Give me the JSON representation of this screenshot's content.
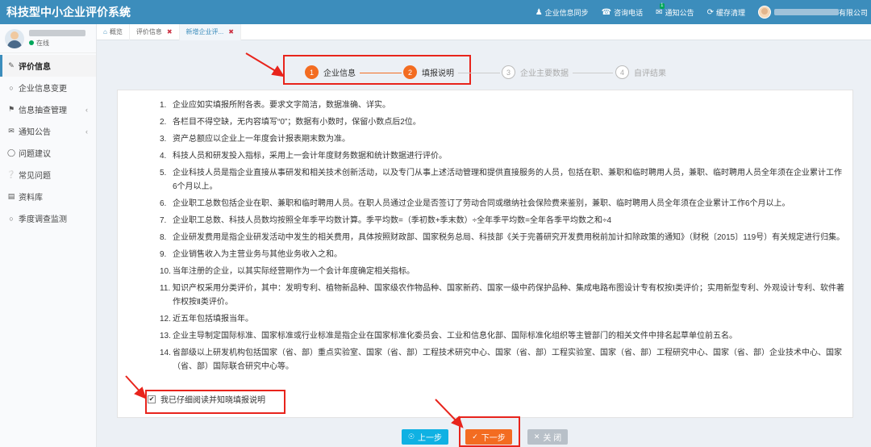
{
  "app": {
    "title": "科技型中小企业评价系统"
  },
  "topnav": {
    "items": [
      {
        "label": "企业信息同步",
        "icon": "user-icon"
      },
      {
        "label": "咨询电话",
        "icon": "phone-icon"
      },
      {
        "label": "通知公告",
        "icon": "envelope-icon",
        "badge": "1"
      },
      {
        "label": "缓存清理",
        "icon": "refresh-icon"
      }
    ],
    "company_suffix": "有限公司"
  },
  "user": {
    "status": "在线"
  },
  "sidebar": {
    "items": [
      {
        "label": "评价信息",
        "icon": "edit-icon",
        "active": true
      },
      {
        "label": "企业信息变更",
        "icon": "circle-icon"
      },
      {
        "label": "信息抽查管理",
        "icon": "tag-icon",
        "has_arrow": true
      },
      {
        "label": "通知公告",
        "icon": "envelope-icon",
        "has_arrow": true
      },
      {
        "label": "问题建议",
        "icon": "comment-icon"
      },
      {
        "label": "常见问题",
        "icon": "question-icon"
      },
      {
        "label": "资料库",
        "icon": "folder-icon"
      },
      {
        "label": "季度调查监测",
        "icon": "circle-icon"
      }
    ]
  },
  "tabs": [
    {
      "label": "概览",
      "icon": "home-icon"
    },
    {
      "label": "评价信息",
      "closable": true
    },
    {
      "label": "新增企业评...",
      "closable": true,
      "active": true
    }
  ],
  "steps": [
    {
      "num": "1",
      "label": "企业信息",
      "state": "done"
    },
    {
      "num": "2",
      "label": "填报说明",
      "state": "done"
    },
    {
      "num": "3",
      "label": "企业主要数据",
      "state": "todo"
    },
    {
      "num": "4",
      "label": "自评结果",
      "state": "todo"
    }
  ],
  "instructions": [
    {
      "n": "1.",
      "text": "企业应如实填报所附各表。要求文字简洁，数据准确、详实。"
    },
    {
      "n": "2.",
      "text": "各栏目不得空缺，无内容填写“0”；数据有小数时，保留小数点后2位。"
    },
    {
      "n": "3.",
      "text": "资产总额应以企业上一年度会计报表期末数为准。"
    },
    {
      "n": "4.",
      "text": "科技人员和研发投入指标，采用上一会计年度财务数据和统计数据进行评价。"
    },
    {
      "n": "5.",
      "text": "企业科技人员是指企业直接从事研发和相关技术创新活动，以及专门从事上述活动管理和提供直接服务的人员，包括在职、兼职和临时聘用人员，兼职、临时聘用人员全年须在企业累计工作6个月以上。"
    },
    {
      "n": "6.",
      "text": "企业职工总数包括企业在职、兼职和临时聘用人员。在职人员通过企业是否签订了劳动合同或缴纳社会保险费来鉴别，兼职、临时聘用人员全年须在企业累计工作6个月以上。"
    },
    {
      "n": "7.",
      "text": "企业职工总数、科技人员数均按照全年季平均数计算。季平均数=（季初数+季末数）÷全年季平均数=全年各季平均数之和÷4"
    },
    {
      "n": "8.",
      "text": "企业研发费用是指企业研发活动中发生的相关费用，具体按照财政部、国家税务总局、科技部《关于完善研究开发费用税前加计扣除政策的通知》（财税〔2015〕119号）有关规定进行归集。"
    },
    {
      "n": "9.",
      "text": "企业销售收入为主营业务与其他业务收入之和。"
    },
    {
      "n": "10.",
      "text": "当年注册的企业，以其实际经营期作为一个会计年度确定相关指标。"
    },
    {
      "n": "11.",
      "text": "知识产权采用分类评价，其中：发明专利、植物新品种、国家级农作物品种、国家新药、国家一级中药保护品种、集成电路布图设计专有权按Ⅰ类评价；实用新型专利、外观设计专利、软件著作权按Ⅱ类评价。"
    },
    {
      "n": "12.",
      "text": "近五年包括填报当年。"
    },
    {
      "n": "13.",
      "text": "企业主导制定国际标准、国家标准或行业标准是指企业在国家标准化委员会、工业和信息化部、国际标准化组织等主管部门的相关文件中排名起草单位前五名。"
    },
    {
      "n": "14.",
      "text": "省部级以上研发机构包括国家（省、部）重点实验室、国家（省、部）工程技术研究中心、国家（省、部）工程实验室、国家（省、部）工程研究中心、国家（省、部）企业技术中心、国家（省、部）国际联合研究中心等。"
    }
  ],
  "agree": {
    "label": "我已仔细阅读并知晓填报说明",
    "checked": true
  },
  "buttons": {
    "prev": "上一步",
    "next": "下一步",
    "close": "关 闭"
  },
  "colors": {
    "header": "#3c8dbc",
    "accent": "#f36c21",
    "prev_button": "#0fb1e3",
    "close_button": "#b8c0c8",
    "annotation": "#e8241c"
  }
}
